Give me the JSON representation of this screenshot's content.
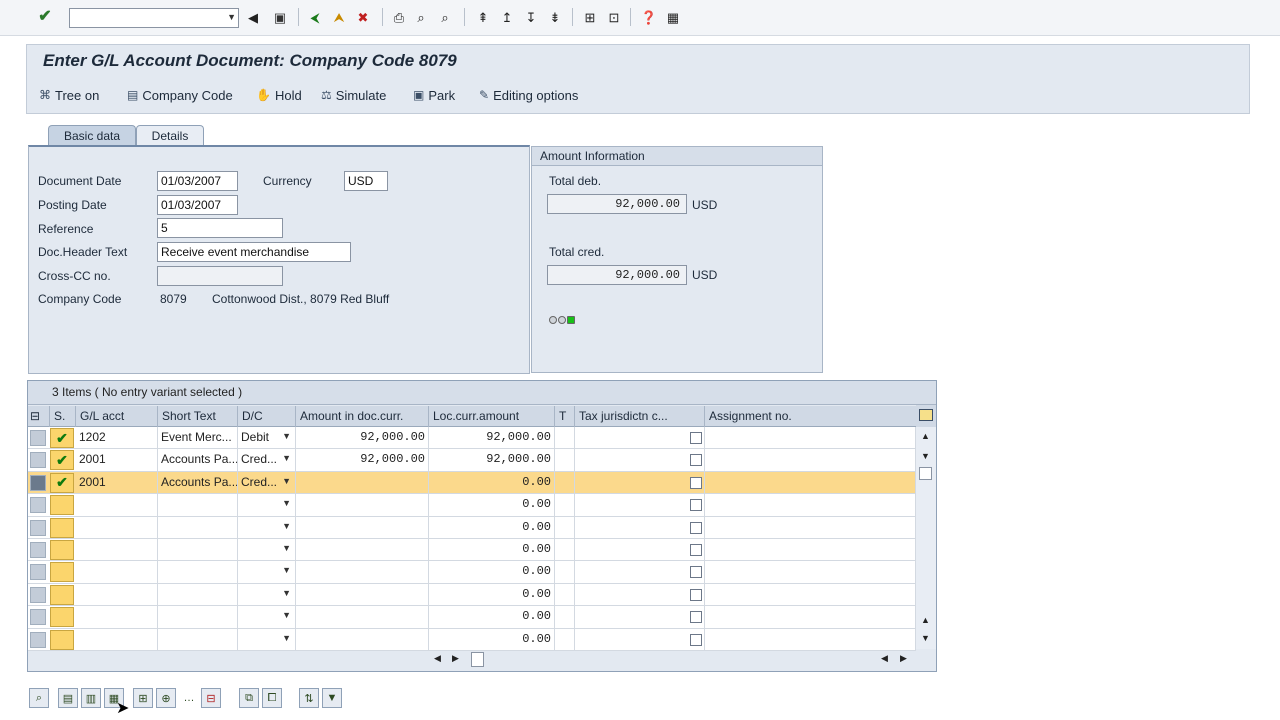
{
  "title": "Enter G/L Account Document: Company Code 8079",
  "app_toolbar": {
    "tree_on": "Tree on",
    "company_code": "Company Code",
    "hold": "Hold",
    "simulate": "Simulate",
    "park": "Park",
    "editing_options": "Editing options"
  },
  "tabs": {
    "basic": "Basic data",
    "details": "Details"
  },
  "basic": {
    "document_date_label": "Document Date",
    "document_date": "01/03/2007",
    "currency_label": "Currency",
    "currency": "USD",
    "posting_date_label": "Posting Date",
    "posting_date": "01/03/2007",
    "reference_label": "Reference",
    "reference": "5",
    "header_text_label": "Doc.Header Text",
    "header_text": "Receive event merchandise",
    "cross_cc_label": "Cross-CC no.",
    "cross_cc": "",
    "company_code_label": "Company Code",
    "company_code": "8079",
    "company_name": "Cottonwood Dist., 8079 Red Bluff"
  },
  "amount_info": {
    "header": "Amount Information",
    "total_deb_label": "Total deb.",
    "total_deb": "92,000.00",
    "total_deb_cur": "USD",
    "total_cred_label": "Total cred.",
    "total_cred": "92,000.00",
    "total_cred_cur": "USD"
  },
  "items": {
    "caption": "3 Items ( No entry variant selected )",
    "columns": {
      "s": "S.",
      "gl": "G/L acct",
      "short": "Short Text",
      "dc": "D/C",
      "amt_doc": "Amount in doc.curr.",
      "amt_loc": "Loc.curr.amount",
      "t": "T",
      "tax": "Tax jurisdictn c...",
      "assign": "Assignment no."
    },
    "rows": [
      {
        "gl": "1202",
        "short": "Event Merc...",
        "dc": "Debit",
        "amt_doc": "92,000.00",
        "amt_loc": "92,000.00"
      },
      {
        "gl": "2001",
        "short": "Accounts Pa...",
        "dc": "Cred...",
        "amt_doc": "92,000.00",
        "amt_loc": "92,000.00"
      },
      {
        "gl": "2001",
        "short": "Accounts Pa...",
        "dc": "Cred...",
        "amt_doc": "",
        "amt_loc": "0.00"
      },
      {
        "gl": "",
        "short": "",
        "dc": "",
        "amt_doc": "",
        "amt_loc": "0.00"
      },
      {
        "gl": "",
        "short": "",
        "dc": "",
        "amt_doc": "",
        "amt_loc": "0.00"
      },
      {
        "gl": "",
        "short": "",
        "dc": "",
        "amt_doc": "",
        "amt_loc": "0.00"
      },
      {
        "gl": "",
        "short": "",
        "dc": "",
        "amt_doc": "",
        "amt_loc": "0.00"
      },
      {
        "gl": "",
        "short": "",
        "dc": "",
        "amt_doc": "",
        "amt_loc": "0.00"
      },
      {
        "gl": "",
        "short": "",
        "dc": "",
        "amt_doc": "",
        "amt_loc": "0.00"
      },
      {
        "gl": "",
        "short": "",
        "dc": "",
        "amt_doc": "",
        "amt_loc": "0.00"
      }
    ]
  },
  "colors": {
    "selected_row": "#fbd98c",
    "frame": "#e3e9f1",
    "status_green": "#18c018"
  }
}
